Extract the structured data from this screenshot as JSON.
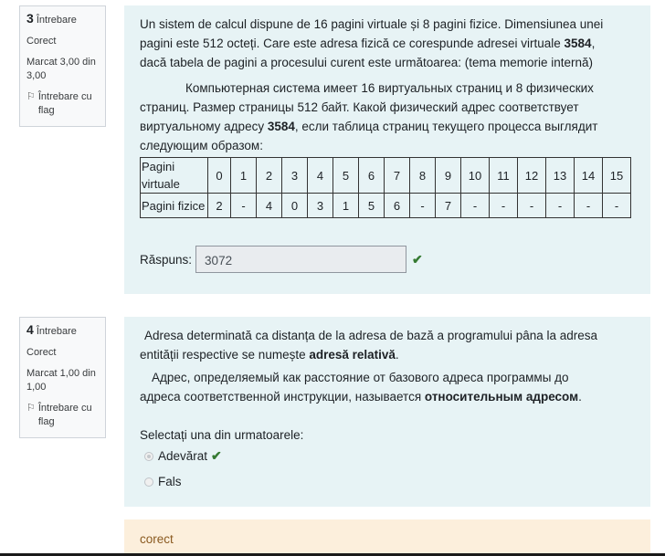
{
  "q3": {
    "number": "3",
    "label": "Întrebare",
    "state": "Corect",
    "mark": "Marcat 3,00 din 3,00",
    "flag_label": "Întrebare cu flag",
    "text_ro_1": "Un sistem de calcul dispune de 16 pagini virtuale și 8 pagini fizice. Dimensiunea unei pagini este 512 octeți. Care este adresa fizică ce corespunde adresei virtuale ",
    "text_ro_bold": "3584",
    "text_ro_2": ", dacă tabela de pagini a procesului curent este următoarea:   (tema memorie internă)",
    "text_ru_1": "Компьютерная система имеет 16 виртуальных страниц и 8 физических страниц. Размер страницы 512 байт. Какой физический адрес соответствует виртуальному адресу ",
    "text_ru_bold": "3584",
    "text_ru_2": ", если таблица страниц текущего процесса выглядит следующим образом:",
    "table": {
      "row1_header": "Pagini virtuale",
      "row2_header": "Pagini fizice",
      "virtual": [
        "0",
        "1",
        "2",
        "3",
        "4",
        "5",
        "6",
        "7",
        "8",
        "9",
        "10",
        "11",
        "12",
        "13",
        "14",
        "15"
      ],
      "physical": [
        "2",
        "-",
        "4",
        "0",
        "3",
        "1",
        "5",
        "6",
        "-",
        "7",
        "-",
        "-",
        "-",
        "-",
        "-",
        "-"
      ]
    },
    "answer_label": "Răspuns:",
    "answer_value": "3072"
  },
  "q4": {
    "number": "4",
    "label": "Întrebare",
    "state": "Corect",
    "mark": "Marcat 1,00 din 1,00",
    "flag_label": "Întrebare cu flag",
    "text_ro_1": "Adresa determinată ca distanța de la adresa de bază a programului pâna la adresa entității respective se numește ",
    "text_ro_bold": "adresă relativă",
    "text_ro_2": ".",
    "text_ru_1": "Адрес, определяемый как расстояние от базового адреса программы до адреса соответственной инструкции, называется ",
    "text_ru_bold": "относительным адресом",
    "text_ru_2": ".",
    "prompt": "Selectați una din urmatoarele:",
    "options": [
      {
        "label": "Adevărat",
        "selected": true,
        "correct": true
      },
      {
        "label": "Fals",
        "selected": false,
        "correct": false
      }
    ],
    "feedback": "corect"
  },
  "colors": {
    "content_bg": "#e7f3f5",
    "feedback_bg": "#fcefdc",
    "correct_check": "#357a32"
  }
}
